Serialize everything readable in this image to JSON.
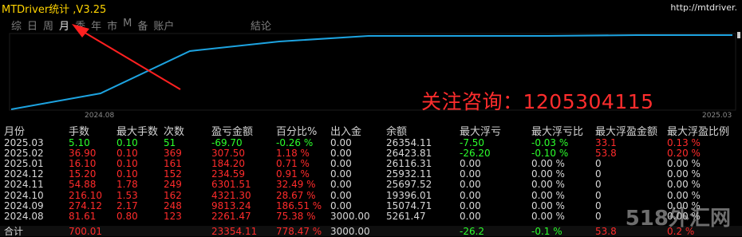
{
  "app": {
    "title": "MTDriver统计 ,V3.25",
    "url": "http://mtdriver."
  },
  "tabs": [
    {
      "label": "综",
      "active": false
    },
    {
      "label": "日",
      "active": false
    },
    {
      "label": "周",
      "active": false
    },
    {
      "label": "月",
      "active": true
    },
    {
      "label": "季",
      "active": false
    },
    {
      "label": "年",
      "active": false
    },
    {
      "label": "市",
      "active": false
    },
    {
      "label": "M",
      "active": false
    },
    {
      "label": "备",
      "active": false
    },
    {
      "label": "账户",
      "active": false
    }
  ],
  "tab_extra": "結论",
  "chart": {
    "x_start_label": "2024.08",
    "x_end_label": "2025.03",
    "line_color": "#1da3e0"
  },
  "promo": "关注咨询：1205304115",
  "table": {
    "headers": [
      "月份",
      "手数",
      "最大手数",
      "次数",
      "盈亏金额",
      "百分比%",
      "出入金",
      "余额",
      "最大浮亏",
      "最大浮亏比",
      "最大浮盈金额",
      "最大浮盈比例"
    ],
    "rows": [
      [
        "2025.03",
        "5.10",
        "0.10",
        "51",
        "-69.70",
        "-0.26 %",
        "0.00",
        "26354.11",
        "-7.50",
        "-0.03 %",
        "33.1",
        "0.13 %"
      ],
      [
        "2025.02",
        "36.90",
        "0.10",
        "369",
        "307.50",
        "1.18 %",
        "0.00",
        "26423.81",
        "-26.20",
        "-0.10 %",
        "53.8",
        "0.20 %"
      ],
      [
        "2025.01",
        "16.10",
        "0.10",
        "161",
        "184.20",
        "0.71 %",
        "0.00",
        "26116.31",
        "0.00",
        "0.00 %",
        "0",
        "0.00 %"
      ],
      [
        "2024.12",
        "15.20",
        "0.10",
        "152",
        "234.59",
        "0.91 %",
        "0.00",
        "25932.11",
        "0.00",
        "0.00 %",
        "0",
        "0.00 %"
      ],
      [
        "2024.11",
        "54.88",
        "1.78",
        "249",
        "6301.51",
        "32.49 %",
        "0.00",
        "25697.52",
        "0.00",
        "0.00 %",
        "0",
        "0.00 %"
      ],
      [
        "2024.10",
        "216.10",
        "1.53",
        "162",
        "4321.30",
        "28.67 %",
        "0.00",
        "19396.01",
        "0.00",
        "0.00 %",
        "0",
        "0.00 %"
      ],
      [
        "2024.09",
        "274.12",
        "2.17",
        "248",
        "9813.24",
        "186.51 %",
        "0.00",
        "15074.71",
        "0.00",
        "0.00 %",
        "0",
        "0.00 %"
      ],
      [
        "2024.08",
        "81.61",
        "0.80",
        "123",
        "2261.47",
        "75.38 %",
        "3000.00",
        "5261.47",
        "0.00",
        "0.00 %",
        "0",
        "0.00 %"
      ]
    ],
    "total": [
      "合计",
      "700.01",
      "",
      "",
      "23354.11",
      "778.47 %",
      "3000.00",
      "",
      "-26.2",
      "-0.1 %",
      "53.8",
      "0.2 %"
    ]
  },
  "watermark": "518外汇网",
  "colors": {
    "positive": "#ff2b2b",
    "negative": "#2cff2c",
    "title": "#ffd400",
    "promo": "#ff2d2d"
  }
}
